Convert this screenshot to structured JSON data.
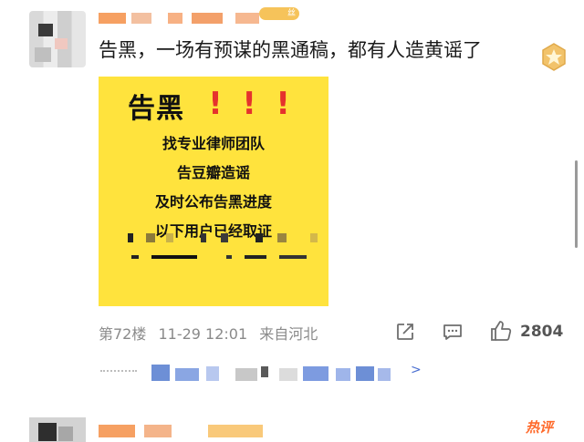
{
  "post": {
    "text": "告黑，一场有预谋的黑通稿，都有人造黄谣了",
    "vip_label": "丝"
  },
  "notice": {
    "title": "告黑",
    "exclaims": [
      "!",
      "!",
      "!"
    ],
    "lines": [
      "找专业律师团队",
      "告豆瓣造谣",
      "及时公布告黑进度",
      "以下用户已经取证"
    ]
  },
  "meta": {
    "floor": "第72楼",
    "datetime": "11-29 12:01",
    "source": "来自河北"
  },
  "actions": {
    "like_count": "2804"
  },
  "reply": {
    "chevron": ">"
  },
  "footer": {
    "hot_comment_label": "热评"
  },
  "colors": {
    "notice_bg": "#ffe33d",
    "exclaim": "#e5322d",
    "meta_text": "#8a8a8a",
    "hot_comment": "#ff6a2b",
    "username_blur": "#f8a05a"
  },
  "icons": {
    "medal": "medal-icon",
    "share": "share-icon",
    "comment": "comment-icon",
    "like": "thumbs-up-icon"
  }
}
